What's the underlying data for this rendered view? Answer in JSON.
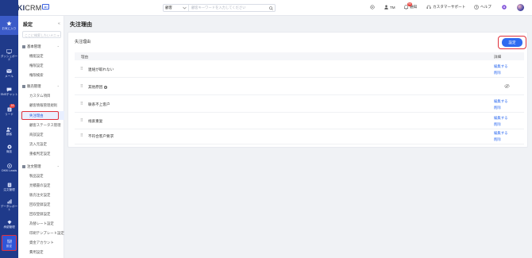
{
  "topbar": {
    "logo_main": "OKKI",
    "logo_crm": "CRM",
    "logo_badge": "AI",
    "search_scope": "顧客",
    "search_placeholder": "顧客キーワードを入力してください",
    "user_initials": "TM",
    "notify_label": "通知",
    "notify_count": "99",
    "support_label": "カスタマーサポート",
    "help_label": "ヘルプ"
  },
  "rail": {
    "items": [
      {
        "label": "お気に入り",
        "icon": "star-icon"
      },
      {
        "label": "ダッシュボード",
        "icon": "dashboard-icon"
      },
      {
        "label": "メール",
        "icon": "mail-icon"
      },
      {
        "label": "SNSチャット",
        "icon": "chat-icon"
      },
      {
        "label": "リード",
        "icon": "lead-icon",
        "badge": "16"
      },
      {
        "label": "顧客",
        "icon": "customer-icon"
      },
      {
        "label": "商談",
        "icon": "deal-icon"
      },
      {
        "label": "OKKI Leads",
        "icon": "okki-leads-icon"
      },
      {
        "label": "注文管理",
        "icon": "order-icon"
      },
      {
        "label": "データレポート",
        "icon": "report-icon"
      },
      {
        "label": "承認管理",
        "icon": "approval-icon"
      },
      {
        "label": "設定",
        "icon": "settings-icon"
      }
    ]
  },
  "sidebar": {
    "title": "設定",
    "search_placeholder": "ここに検索したいメニューを入力してください",
    "groups": [
      {
        "label": "基本管理",
        "items": [
          "機能設定",
          "権限設定",
          "権限検索"
        ]
      },
      {
        "label": "販売管理",
        "items": [
          "カスタム項目",
          "顧客情報管理規則",
          "失注理由",
          "顧客ステータス管理",
          "商談設定",
          "流入元設定",
          "重複判定設定"
        ]
      },
      {
        "label": "注文管理",
        "items": [
          "製品設定",
          "見積書の設定",
          "販売注文設定",
          "回収登録設定",
          "回収登録設定",
          "為替レート設定",
          "印刷テンプレート設定",
          "資金アカウント",
          "費用設定"
        ]
      }
    ]
  },
  "main": {
    "page_title": "失注理由",
    "card_title": "失注理由",
    "setting_button": "設定",
    "col_reason": "理由",
    "col_detail": "詳細",
    "edit_label": "編集する",
    "delete_label": "削除",
    "rows": [
      {
        "name": "連絡が取れない",
        "type": "editable"
      },
      {
        "name": "其他原因",
        "type": "system"
      },
      {
        "name": "联系不上客户",
        "type": "editable"
      },
      {
        "name": "线索重复",
        "type": "editable"
      },
      {
        "name": "不符合客户要求",
        "type": "editable"
      }
    ]
  },
  "colors": {
    "rail_bg": "#1f3a8a",
    "accent": "#2f6bf0",
    "highlight": "#e0303a"
  }
}
